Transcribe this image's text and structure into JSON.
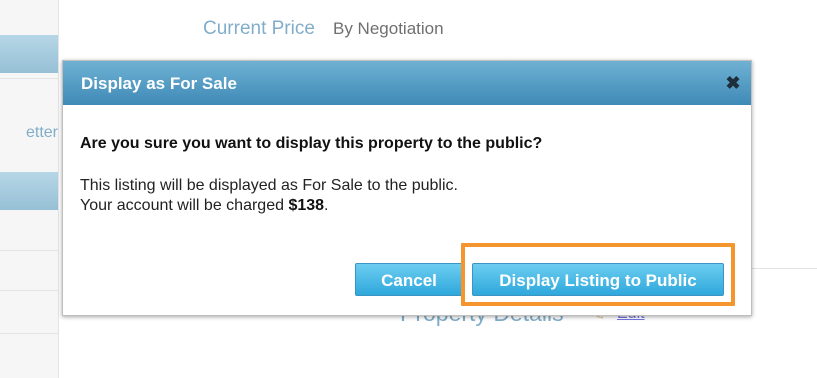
{
  "background": {
    "sidebar_text": "etter",
    "current_price_label": "Current Price",
    "current_price_value": "By Negotiation",
    "property_details_heading": "Property Details",
    "edit_link": "Edit"
  },
  "dialog": {
    "title": "Display as For Sale",
    "close_glyph": "✖",
    "question": "Are you sure you want to display this property to the public?",
    "info_line1": "This listing will be displayed as For Sale to the public.",
    "info_line2_prefix": "Your account will be charged ",
    "charge_amount": "$138",
    "info_line2_suffix": ".",
    "cancel_label": "Cancel",
    "confirm_label": "Display Listing to Public"
  },
  "colors": {
    "header_gradient": [
      "#6fb1d3",
      "#3f8ab7"
    ],
    "button_gradient": [
      "#6ccdf0",
      "#2ea8dc"
    ],
    "link_blue": "#3e82ad",
    "highlight_orange": "#f4962d"
  },
  "icons": {
    "close": "close-icon",
    "edit": "pencil-icon"
  }
}
